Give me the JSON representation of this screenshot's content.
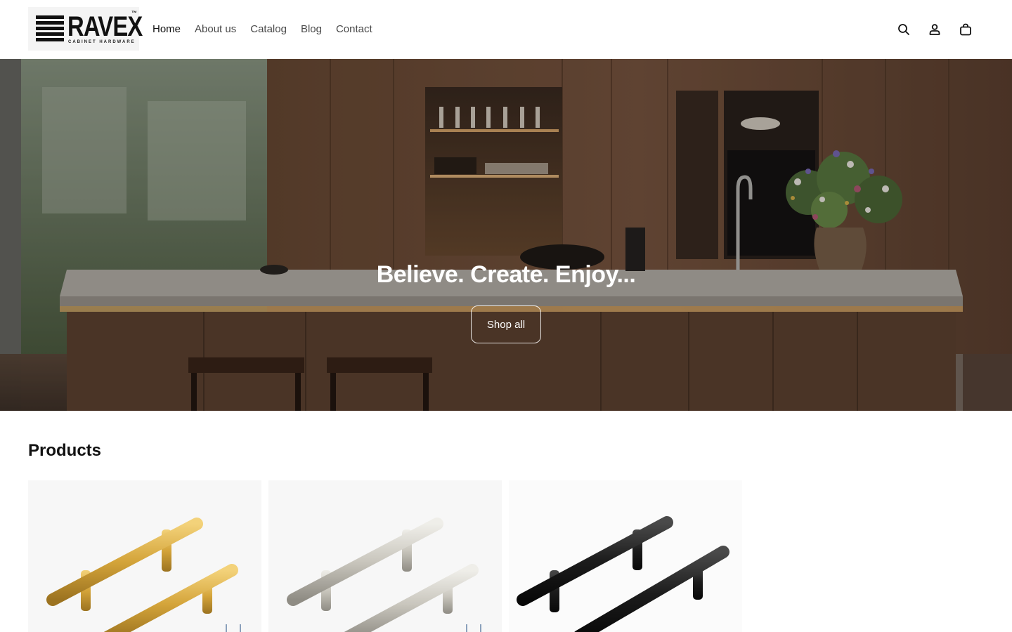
{
  "brand": {
    "name": "RAVEX",
    "tm": "™",
    "tagline": "CABINET HARDWARE"
  },
  "nav": {
    "items": [
      {
        "label": "Home"
      },
      {
        "label": "About us"
      },
      {
        "label": "Catalog"
      },
      {
        "label": "Blog"
      },
      {
        "label": "Contact"
      }
    ]
  },
  "header_icons": {
    "search": "search-icon",
    "account": "account-icon",
    "cart": "cart-icon"
  },
  "hero": {
    "title": "Believe. Create. Enjoy...",
    "button_label": "Shop all"
  },
  "products": {
    "heading": "Products",
    "items": [
      {
        "finish": "gold"
      },
      {
        "finish": "brushed nickel"
      },
      {
        "finish": "matte black"
      }
    ]
  }
}
